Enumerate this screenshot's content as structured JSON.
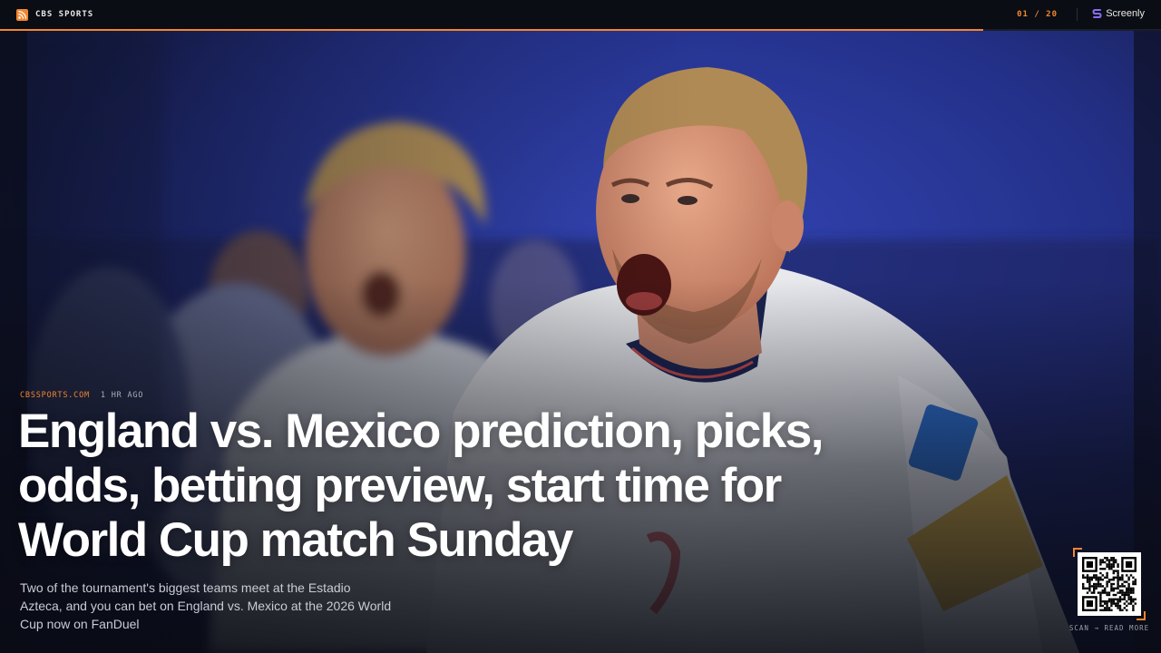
{
  "topbar": {
    "source_name": "CBS SPORTS",
    "counter": "01 / 20",
    "brand_name": "Screenly",
    "progress_fraction": 0.847
  },
  "article": {
    "site": "CBSSPORTS.COM",
    "age": "1 HR AGO",
    "headline": "England vs. Mexico prediction, picks, odds, betting preview, start time for World Cup match Sunday",
    "dek": "Two of the tournament's biggest teams meet at the Estadio Azteca, and you can bet on England vs. Mexico at the 2026 World Cup now on FanDuel"
  },
  "qr": {
    "label": "SCAN → READ MORE"
  },
  "colors": {
    "accent": "#f2862e",
    "background": "#0a0d13",
    "headline": "#ffffff"
  },
  "icons": {
    "source": "rss-icon",
    "brand": "screenly-logo-icon"
  }
}
